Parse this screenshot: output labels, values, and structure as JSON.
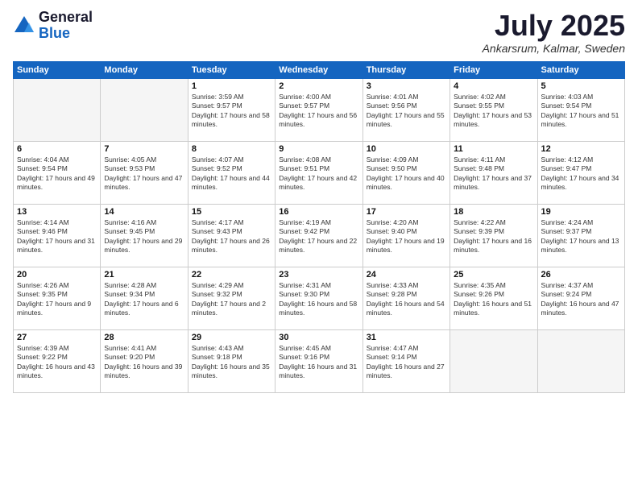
{
  "logo": {
    "general": "General",
    "blue": "Blue"
  },
  "header": {
    "month": "July 2025",
    "location": "Ankarsrum, Kalmar, Sweden"
  },
  "weekdays": [
    "Sunday",
    "Monday",
    "Tuesday",
    "Wednesday",
    "Thursday",
    "Friday",
    "Saturday"
  ],
  "weeks": [
    [
      {
        "day": "",
        "empty": true
      },
      {
        "day": "",
        "empty": true
      },
      {
        "day": "1",
        "sunrise": "Sunrise: 3:59 AM",
        "sunset": "Sunset: 9:57 PM",
        "daylight": "Daylight: 17 hours and 58 minutes."
      },
      {
        "day": "2",
        "sunrise": "Sunrise: 4:00 AM",
        "sunset": "Sunset: 9:57 PM",
        "daylight": "Daylight: 17 hours and 56 minutes."
      },
      {
        "day": "3",
        "sunrise": "Sunrise: 4:01 AM",
        "sunset": "Sunset: 9:56 PM",
        "daylight": "Daylight: 17 hours and 55 minutes."
      },
      {
        "day": "4",
        "sunrise": "Sunrise: 4:02 AM",
        "sunset": "Sunset: 9:55 PM",
        "daylight": "Daylight: 17 hours and 53 minutes."
      },
      {
        "day": "5",
        "sunrise": "Sunrise: 4:03 AM",
        "sunset": "Sunset: 9:54 PM",
        "daylight": "Daylight: 17 hours and 51 minutes."
      }
    ],
    [
      {
        "day": "6",
        "sunrise": "Sunrise: 4:04 AM",
        "sunset": "Sunset: 9:54 PM",
        "daylight": "Daylight: 17 hours and 49 minutes."
      },
      {
        "day": "7",
        "sunrise": "Sunrise: 4:05 AM",
        "sunset": "Sunset: 9:53 PM",
        "daylight": "Daylight: 17 hours and 47 minutes."
      },
      {
        "day": "8",
        "sunrise": "Sunrise: 4:07 AM",
        "sunset": "Sunset: 9:52 PM",
        "daylight": "Daylight: 17 hours and 44 minutes."
      },
      {
        "day": "9",
        "sunrise": "Sunrise: 4:08 AM",
        "sunset": "Sunset: 9:51 PM",
        "daylight": "Daylight: 17 hours and 42 minutes."
      },
      {
        "day": "10",
        "sunrise": "Sunrise: 4:09 AM",
        "sunset": "Sunset: 9:50 PM",
        "daylight": "Daylight: 17 hours and 40 minutes."
      },
      {
        "day": "11",
        "sunrise": "Sunrise: 4:11 AM",
        "sunset": "Sunset: 9:48 PM",
        "daylight": "Daylight: 17 hours and 37 minutes."
      },
      {
        "day": "12",
        "sunrise": "Sunrise: 4:12 AM",
        "sunset": "Sunset: 9:47 PM",
        "daylight": "Daylight: 17 hours and 34 minutes."
      }
    ],
    [
      {
        "day": "13",
        "sunrise": "Sunrise: 4:14 AM",
        "sunset": "Sunset: 9:46 PM",
        "daylight": "Daylight: 17 hours and 31 minutes."
      },
      {
        "day": "14",
        "sunrise": "Sunrise: 4:16 AM",
        "sunset": "Sunset: 9:45 PM",
        "daylight": "Daylight: 17 hours and 29 minutes."
      },
      {
        "day": "15",
        "sunrise": "Sunrise: 4:17 AM",
        "sunset": "Sunset: 9:43 PM",
        "daylight": "Daylight: 17 hours and 26 minutes."
      },
      {
        "day": "16",
        "sunrise": "Sunrise: 4:19 AM",
        "sunset": "Sunset: 9:42 PM",
        "daylight": "Daylight: 17 hours and 22 minutes."
      },
      {
        "day": "17",
        "sunrise": "Sunrise: 4:20 AM",
        "sunset": "Sunset: 9:40 PM",
        "daylight": "Daylight: 17 hours and 19 minutes."
      },
      {
        "day": "18",
        "sunrise": "Sunrise: 4:22 AM",
        "sunset": "Sunset: 9:39 PM",
        "daylight": "Daylight: 17 hours and 16 minutes."
      },
      {
        "day": "19",
        "sunrise": "Sunrise: 4:24 AM",
        "sunset": "Sunset: 9:37 PM",
        "daylight": "Daylight: 17 hours and 13 minutes."
      }
    ],
    [
      {
        "day": "20",
        "sunrise": "Sunrise: 4:26 AM",
        "sunset": "Sunset: 9:35 PM",
        "daylight": "Daylight: 17 hours and 9 minutes."
      },
      {
        "day": "21",
        "sunrise": "Sunrise: 4:28 AM",
        "sunset": "Sunset: 9:34 PM",
        "daylight": "Daylight: 17 hours and 6 minutes."
      },
      {
        "day": "22",
        "sunrise": "Sunrise: 4:29 AM",
        "sunset": "Sunset: 9:32 PM",
        "daylight": "Daylight: 17 hours and 2 minutes."
      },
      {
        "day": "23",
        "sunrise": "Sunrise: 4:31 AM",
        "sunset": "Sunset: 9:30 PM",
        "daylight": "Daylight: 16 hours and 58 minutes."
      },
      {
        "day": "24",
        "sunrise": "Sunrise: 4:33 AM",
        "sunset": "Sunset: 9:28 PM",
        "daylight": "Daylight: 16 hours and 54 minutes."
      },
      {
        "day": "25",
        "sunrise": "Sunrise: 4:35 AM",
        "sunset": "Sunset: 9:26 PM",
        "daylight": "Daylight: 16 hours and 51 minutes."
      },
      {
        "day": "26",
        "sunrise": "Sunrise: 4:37 AM",
        "sunset": "Sunset: 9:24 PM",
        "daylight": "Daylight: 16 hours and 47 minutes."
      }
    ],
    [
      {
        "day": "27",
        "sunrise": "Sunrise: 4:39 AM",
        "sunset": "Sunset: 9:22 PM",
        "daylight": "Daylight: 16 hours and 43 minutes."
      },
      {
        "day": "28",
        "sunrise": "Sunrise: 4:41 AM",
        "sunset": "Sunset: 9:20 PM",
        "daylight": "Daylight: 16 hours and 39 minutes."
      },
      {
        "day": "29",
        "sunrise": "Sunrise: 4:43 AM",
        "sunset": "Sunset: 9:18 PM",
        "daylight": "Daylight: 16 hours and 35 minutes."
      },
      {
        "day": "30",
        "sunrise": "Sunrise: 4:45 AM",
        "sunset": "Sunset: 9:16 PM",
        "daylight": "Daylight: 16 hours and 31 minutes."
      },
      {
        "day": "31",
        "sunrise": "Sunrise: 4:47 AM",
        "sunset": "Sunset: 9:14 PM",
        "daylight": "Daylight: 16 hours and 27 minutes."
      },
      {
        "day": "",
        "empty": true
      },
      {
        "day": "",
        "empty": true
      }
    ]
  ]
}
